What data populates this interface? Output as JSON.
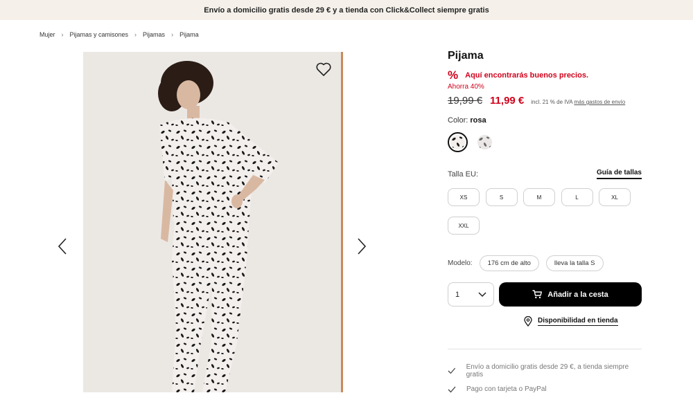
{
  "topbar": {
    "text": "Envío a domicilio gratis desde 29 € y a tienda con Click&Collect siempre gratis"
  },
  "breadcrumb": [
    "Mujer",
    "Pijamas y camisones",
    "Pijamas",
    "Pijama"
  ],
  "icons": {
    "prev": "chevron-left-icon",
    "next": "chevron-right-icon",
    "wishlist": "heart-icon",
    "cart": "cart-icon",
    "location": "location-pin-icon",
    "check": "check-icon"
  },
  "product": {
    "title": "Pijama",
    "promo_symbol": "%",
    "promo_text": "Aquí encontrarás buenos precios.",
    "saving": "Ahorra 40%",
    "old_price": "19,99 €",
    "new_price": "11,99 €",
    "vat_text": "incl. 21 % de IVA",
    "shipping_link": "más gastos de envío",
    "color_label": "Color:",
    "color_value": "rosa",
    "size_label": "Talla EU:",
    "size_guide": "Guía de tallas",
    "sizes": [
      "XS",
      "S",
      "M",
      "L",
      "XL",
      "XXL"
    ],
    "model_label": "Modelo:",
    "model_height": "176 cm de alto",
    "model_size": "lleva la talla S",
    "quantity": "1",
    "add_to_cart": "Añadir a la cesta",
    "availability": "Disponibilidad en tienda",
    "benefits": [
      "Envío a domicilio gratis desde 29 €, a tienda siempre gratis",
      "Pago con tarjeta o PayPal"
    ]
  },
  "colors": {
    "accent_red": "#d0021b",
    "topbar_bg": "#f5f1ea",
    "button_bg": "#000000"
  }
}
